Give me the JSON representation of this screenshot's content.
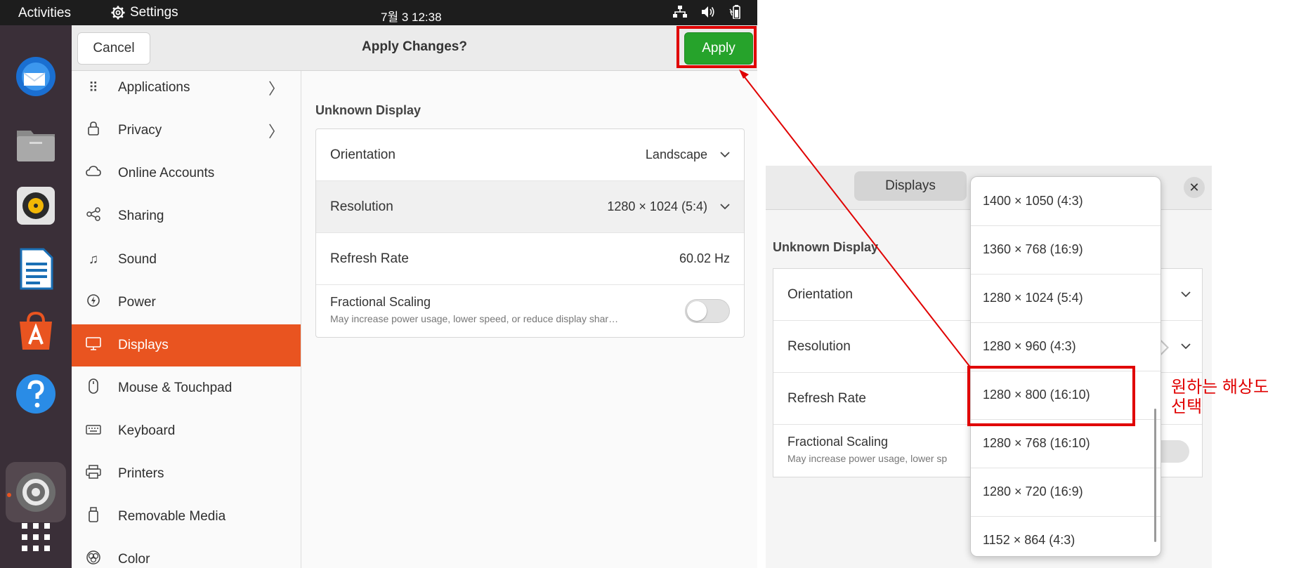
{
  "topbar": {
    "activities": "Activities",
    "app_name": "Settings",
    "clock": "7월 3  12:38"
  },
  "header": {
    "cancel_label": "Cancel",
    "title": "Apply Changes?",
    "apply_label": "Apply"
  },
  "sidebar": {
    "items": [
      {
        "label": "Applications",
        "icon": "apps-grid-icon"
      },
      {
        "label": "Privacy",
        "icon": "lock-icon"
      },
      {
        "label": "Online Accounts",
        "icon": "cloud-icon"
      },
      {
        "label": "Sharing",
        "icon": "share-icon"
      },
      {
        "label": "Sound",
        "icon": "music-note-icon"
      },
      {
        "label": "Power",
        "icon": "power-icon"
      },
      {
        "label": "Displays",
        "icon": "display-icon",
        "active": true
      },
      {
        "label": "Mouse & Touchpad",
        "icon": "mouse-icon"
      },
      {
        "label": "Keyboard",
        "icon": "keyboard-icon"
      },
      {
        "label": "Printers",
        "icon": "printer-icon"
      },
      {
        "label": "Removable Media",
        "icon": "usb-drive-icon"
      },
      {
        "label": "Color",
        "icon": "color-icon"
      }
    ]
  },
  "display": {
    "name": "Unknown Display",
    "orientation_label": "Orientation",
    "orientation_value": "Landscape",
    "resolution_label": "Resolution",
    "resolution_value": "1280 × 1024 (5:4)",
    "refresh_label": "Refresh Rate",
    "refresh_value": "60.02 Hz",
    "scaling_label": "Fractional Scaling",
    "scaling_desc": "May increase power usage, lower speed, or reduce display shar…",
    "scaling_enabled": false
  },
  "inset": {
    "tab_label": "Displays",
    "display_name": "Unknown Display",
    "orientation_label": "Orientation",
    "resolution_label": "Resolution",
    "refresh_label": "Refresh Rate",
    "scaling_label": "Fractional Scaling",
    "scaling_desc": "May increase power usage, lower sp",
    "close_icon": "close-icon"
  },
  "resolution_options": [
    "1400 × 1050 (4:3)",
    "1360 × 768 (16:9)",
    "1280 × 1024 (5:4)",
    "1280 × 960 (4:3)",
    "1280 × 800 (16:10)",
    "1280 × 768 (16:10)",
    "1280 × 720 (16:9)",
    "1152 × 864 (4:3)"
  ],
  "annotation": {
    "line1": "원하는 해상도",
    "line2": "선택",
    "color": "#e00000"
  },
  "colors": {
    "accent": "#e95420",
    "apply_green": "#26a32b",
    "highlight_red": "#e00000"
  }
}
